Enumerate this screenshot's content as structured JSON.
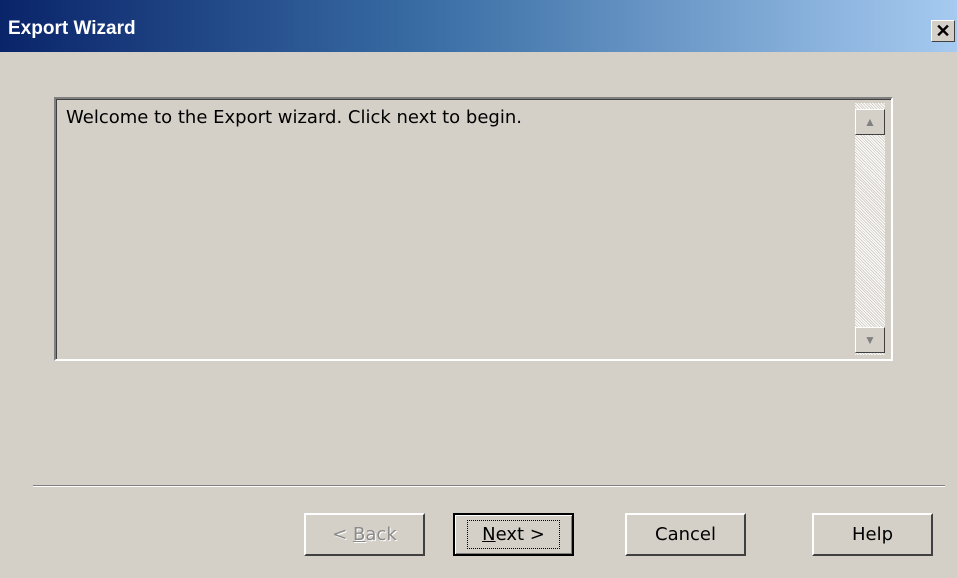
{
  "window": {
    "title": "Export Wizard",
    "close_glyph": "✕"
  },
  "content": {
    "message": "Welcome to the Export wizard. Click next to begin.",
    "scroll_up_glyph": "▲",
    "scroll_down_glyph": "▼"
  },
  "buttons": {
    "back": {
      "prefix": "< ",
      "mnemonic": "B",
      "rest": "ack",
      "enabled": false
    },
    "next": {
      "mnemonic": "N",
      "rest": "ext >",
      "enabled": true,
      "default": true
    },
    "cancel": {
      "label": "Cancel"
    },
    "help": {
      "label": "Help"
    }
  },
  "colors": {
    "titlebar_start": "#0a246a",
    "titlebar_end": "#a6caf0",
    "face": "#d4d0c8"
  }
}
